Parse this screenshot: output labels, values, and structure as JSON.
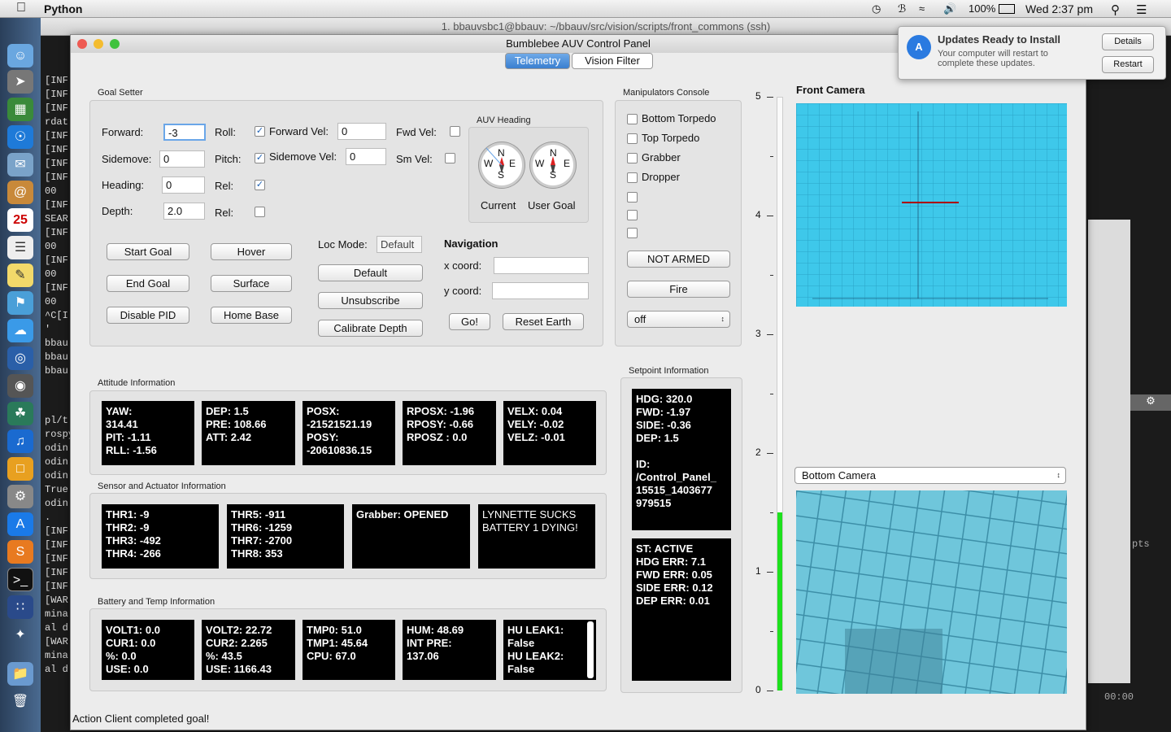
{
  "menubar": {
    "app": "Python",
    "battery": "100%",
    "clock": "Wed 2:37 pm"
  },
  "terminal": {
    "title": "1. bbauvsbc1@bbauv: ~/bbauv/src/vision/scripts/front_commons (ssh)",
    "lines": [
      "[INF",
      "[INF",
      "[INF",
      "rdat",
      "[INF",
      "[INF",
      "[INF",
      "[INF",
      "00",
      "[INF",
      "SEAR",
      "[INF",
      "00",
      "[INF",
      "00",
      "[INF",
      "00",
      "^C[I",
      "'",
      "bbau",
      "bbau",
      "bbau"
    ],
    "lines2": [
      "pl/t",
      "rospy",
      "odin",
      "odin",
      "odin",
      "True",
      "odin",
      ".",
      "[INF",
      "[INF",
      "[INF",
      "[INF",
      "[INF",
      "[WAR",
      "mina",
      "al d",
      "[WAR",
      "mina",
      "al d"
    ],
    "right_time": "00:00",
    "right_pts": "pts"
  },
  "window": {
    "title": "Bumblebee AUV Control Panel",
    "tabs": [
      "Telemetry",
      "Vision Filter"
    ],
    "status": "Action Client completed goal!"
  },
  "goal": {
    "title": "Goal Setter",
    "forward_label": "Forward:",
    "forward": "-3",
    "sidemove_label": "Sidemove:",
    "sidemove": "0",
    "heading_label": "Heading:",
    "heading": "0",
    "depth_label": "Depth:",
    "depth": "2.0",
    "roll": "Roll:",
    "pitch": "Pitch:",
    "rel1": "Rel:",
    "rel2": "Rel:",
    "fwd_vel_label": "Forward Vel:",
    "fwd_vel": "0",
    "sm_vel_label": "Sidemove Vel:",
    "sm_vel": "0",
    "fwd_vel2": "Fwd Vel:",
    "sm_vel2": "Sm Vel:",
    "buttons": [
      "Start Goal",
      "Hover",
      "End Goal",
      "Surface",
      "Disable PID",
      "Home Base"
    ],
    "loc_mode_label": "Loc Mode:",
    "loc_mode": "Default",
    "loc_buttons": [
      "Default",
      "Unsubscribe",
      "Calibrate Depth"
    ],
    "heading_title": "AUV Heading",
    "current": "Current",
    "user_goal": "User Goal",
    "nav": "Navigation",
    "x": "x coord:",
    "y": "y coord:",
    "go": "Go!",
    "reset": "Reset Earth"
  },
  "compass": {
    "n": "N",
    "s": "S",
    "e": "E",
    "w": "W"
  },
  "manip": {
    "title": "Manipulators Console",
    "items": [
      "Bottom Torpedo",
      "Top Torpedo",
      "Grabber",
      "Dropper"
    ],
    "armed": "NOT ARMED",
    "fire": "Fire",
    "mode": "off"
  },
  "attitude": {
    "title": "Attitude Information",
    "boxes": [
      "YAW:\n314.41\nPIT: -1.11\nRLL: -1.56",
      "DEP: 1.5\nPRE: 108.66\nATT: 2.42",
      "POSX:\n-21521521.19\nPOSY:\n-20610836.15",
      "RPOSX: -1.96\nRPOSY: -0.66\nRPOSZ : 0.0",
      "VELX: 0.04\nVELY: -0.02\nVELZ: -0.01"
    ]
  },
  "sensor": {
    "title": "Sensor and Actuator Information",
    "boxes": [
      "THR1: -9\nTHR2: -9\nTHR3: -492\nTHR4: -266",
      "THR5: -911\nTHR6: -1259\nTHR7: -2700\nTHR8: 353",
      "Grabber: OPENED",
      "LYNNETTE SUCKS\nBATTERY 1 DYING!"
    ]
  },
  "battery": {
    "title": "Battery and Temp Information",
    "boxes": [
      "VOLT1: 0.0\nCUR1: 0.0\n%: 0.0\nUSE: 0.0",
      "VOLT2: 22.72\nCUR2: 2.265\n%: 43.5\nUSE: 1166.43",
      "TMP0: 51.0\nTMP1: 45.64\nCPU: 67.0",
      "HUM: 48.69\nINT PRE:\n137.06",
      "HU LEAK1:\nFalse\nHU LEAK2:\nFalse"
    ]
  },
  "setpoint": {
    "title": "Setpoint Information",
    "box1": "HDG: 320.0\nFWD: -1.97\nSIDE: -0.36\nDEP: 1.5\n\nID:\n/Control_Panel_\n15515_1403677\n979515",
    "box2": "ST: ACTIVE\nHDG ERR: 7.1\nFWD ERR: 0.05\nSIDE ERR: 0.12\nDEP ERR: 0.01"
  },
  "depth_gauge": {
    "ticks": [
      "5",
      "4",
      "3",
      "2",
      "1",
      "0"
    ],
    "value": 1.5,
    "max": 5,
    "color": "#1ee01e"
  },
  "cameras": {
    "front": "Front Camera",
    "bottom": "Bottom Camera"
  },
  "notification": {
    "title": "Updates Ready to Install",
    "body": "Your computer will restart to complete these updates.",
    "details": "Details",
    "restart": "Restart"
  }
}
